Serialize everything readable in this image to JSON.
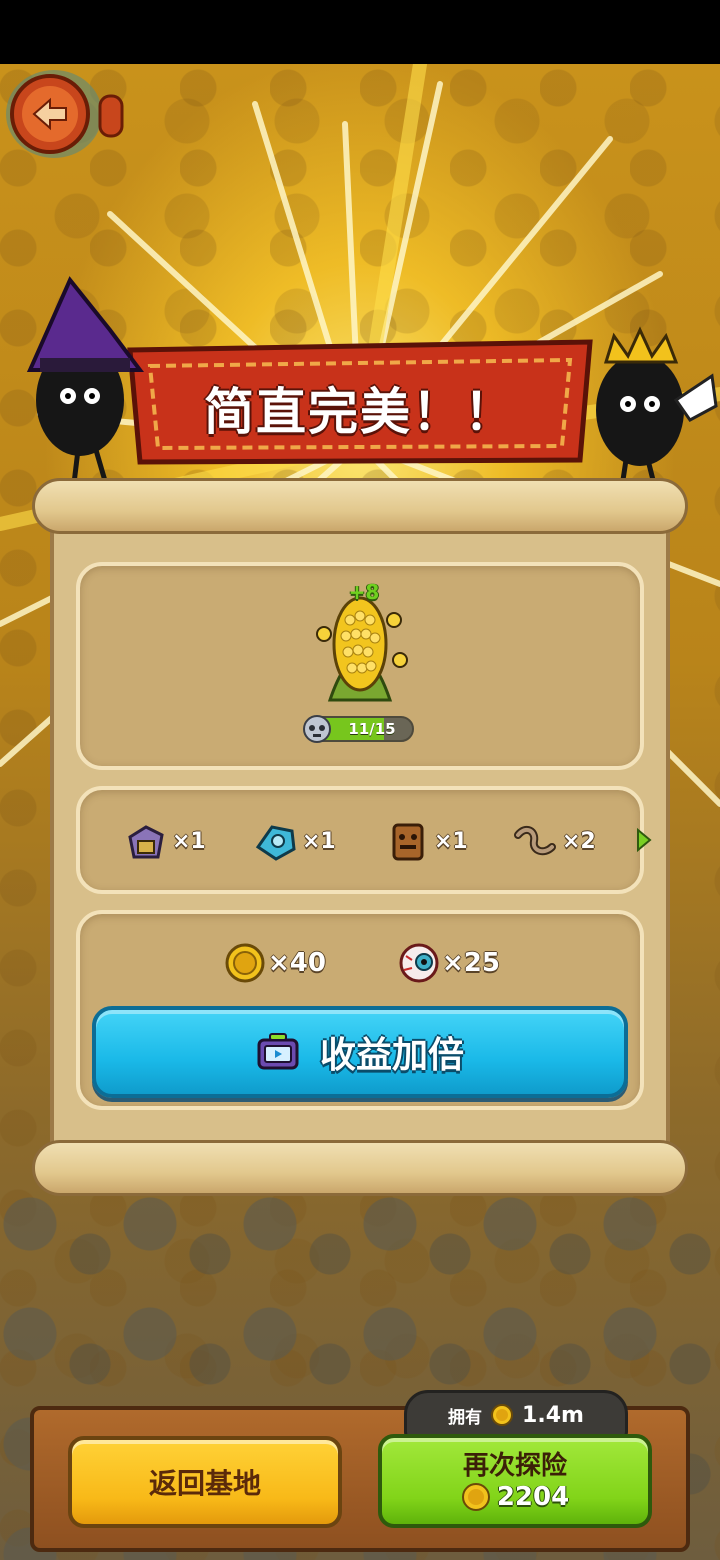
{
  "result": {
    "title": "简直完美！！",
    "crop": {
      "bonus": "+8",
      "progress_text": "11/15",
      "progress_fraction": 0.733,
      "icon": "corn-plant-icon"
    },
    "items": [
      {
        "icon": "armor-chest-icon",
        "count": "×1"
      },
      {
        "icon": "mechanical-part-icon",
        "count": "×1"
      },
      {
        "icon": "wooden-totem-icon",
        "count": "×1"
      },
      {
        "icon": "worm-icon",
        "count": "×2"
      }
    ],
    "rewards": [
      {
        "icon": "gold-coin-icon",
        "count": "×40"
      },
      {
        "icon": "eyeball-icon",
        "count": "×25"
      }
    ],
    "double_button": {
      "label": "收益加倍",
      "icon": "tv-ad-icon"
    }
  },
  "footer": {
    "owned_label": "拥有",
    "owned_value": "1.4m",
    "return_base_label": "返回基地",
    "explore_again_label": "再次探险",
    "explore_again_cost": "2204"
  },
  "colors": {
    "banner_red": "#c8321a",
    "double_button": "#1ab9e8",
    "return_button": "#f8b918",
    "explore_button": "#82d419"
  }
}
